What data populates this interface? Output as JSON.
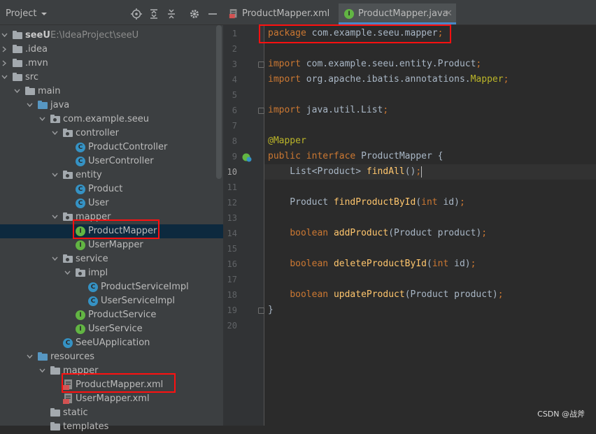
{
  "project": {
    "title": "Project",
    "toolbar_icons": [
      "locate-icon",
      "expand-all-icon",
      "collapse-all-icon",
      "gear-icon",
      "hide-icon"
    ],
    "tree": [
      {
        "label": "seeU",
        "sub": "E:\\IdeaProject\\seeU",
        "kind": "module",
        "expanded": true,
        "depth": 0
      },
      {
        "label": ".idea",
        "kind": "folder",
        "expanded": false,
        "depth": 0
      },
      {
        "label": ".mvn",
        "kind": "folder",
        "expanded": false,
        "depth": 0
      },
      {
        "label": "src",
        "kind": "folder",
        "expanded": true,
        "depth": 0
      },
      {
        "label": "main",
        "kind": "folder",
        "expanded": true,
        "depth": 1
      },
      {
        "label": "java",
        "kind": "source-folder",
        "expanded": true,
        "depth": 2
      },
      {
        "label": "com.example.seeu",
        "kind": "package",
        "expanded": true,
        "depth": 3
      },
      {
        "label": "controller",
        "kind": "package",
        "expanded": true,
        "depth": 4
      },
      {
        "label": "ProductController",
        "kind": "class",
        "depth": 5
      },
      {
        "label": "UserController",
        "kind": "class",
        "depth": 5
      },
      {
        "label": "entity",
        "kind": "package",
        "expanded": true,
        "depth": 4
      },
      {
        "label": "Product",
        "kind": "class",
        "depth": 5
      },
      {
        "label": "User",
        "kind": "class",
        "depth": 5
      },
      {
        "label": "mapper",
        "kind": "package",
        "expanded": true,
        "depth": 4
      },
      {
        "label": "ProductMapper",
        "kind": "interface",
        "depth": 5,
        "selected": true
      },
      {
        "label": "UserMapper",
        "kind": "interface",
        "depth": 5
      },
      {
        "label": "service",
        "kind": "package",
        "expanded": true,
        "depth": 4
      },
      {
        "label": "impl",
        "kind": "package",
        "expanded": true,
        "depth": 5
      },
      {
        "label": "ProductServiceImpl",
        "kind": "class",
        "depth": 6
      },
      {
        "label": "UserServiceImpl",
        "kind": "class",
        "depth": 6
      },
      {
        "label": "ProductService",
        "kind": "interface",
        "depth": 5
      },
      {
        "label": "UserService",
        "kind": "interface",
        "depth": 5
      },
      {
        "label": "SeeUApplication",
        "kind": "app-class",
        "depth": 4
      },
      {
        "label": "resources",
        "kind": "resource-folder",
        "expanded": true,
        "depth": 2
      },
      {
        "label": "mapper",
        "kind": "folder",
        "expanded": true,
        "depth": 3
      },
      {
        "label": "ProductMapper.xml",
        "kind": "xml",
        "depth": 4
      },
      {
        "label": "UserMapper.xml",
        "kind": "xml",
        "depth": 4
      },
      {
        "label": "static",
        "kind": "folder",
        "depth": 3
      },
      {
        "label": "templates",
        "kind": "folder",
        "depth": 3
      }
    ]
  },
  "editor": {
    "tabs": [
      {
        "label": "ProductMapper.xml",
        "icon": "xml-file-icon",
        "active": false
      },
      {
        "label": "ProductMapper.java",
        "icon": "interface-icon",
        "active": true
      }
    ],
    "current_line": 10,
    "lines": [
      [
        {
          "t": "package",
          "c": "kw"
        },
        {
          "t": " com.example.seeu.mapper"
        },
        {
          "t": ";",
          "c": "kw"
        }
      ],
      [],
      [
        {
          "t": "import",
          "c": "kw"
        },
        {
          "t": " com.example.seeu.entity.Product"
        },
        {
          "t": ";",
          "c": "kw"
        }
      ],
      [
        {
          "t": "import",
          "c": "kw"
        },
        {
          "t": " org.apache.ibatis.annotations."
        },
        {
          "t": "Mapper",
          "c": "ann"
        },
        {
          "t": ";",
          "c": "kw"
        }
      ],
      [],
      [
        {
          "t": "import",
          "c": "kw"
        },
        {
          "t": " java.util.List"
        },
        {
          "t": ";",
          "c": "kw"
        }
      ],
      [],
      [
        {
          "t": "@Mapper",
          "c": "ann"
        }
      ],
      [
        {
          "t": "public interface ",
          "c": "kw"
        },
        {
          "t": "ProductMapper {"
        }
      ],
      [
        {
          "t": "    List<Product> "
        },
        {
          "t": "findAll",
          "c": "fn"
        },
        {
          "t": "()"
        },
        {
          "t": ";",
          "c": "kw"
        },
        {
          "caret": true
        }
      ],
      [],
      [
        {
          "t": "    Product "
        },
        {
          "t": "findProductById",
          "c": "fn"
        },
        {
          "t": "("
        },
        {
          "t": "int ",
          "c": "kw"
        },
        {
          "t": "id)"
        },
        {
          "t": ";",
          "c": "kw"
        }
      ],
      [],
      [
        {
          "t": "    "
        },
        {
          "t": "boolean ",
          "c": "kw"
        },
        {
          "t": "addProduct",
          "c": "fn"
        },
        {
          "t": "(Product product)"
        },
        {
          "t": ";",
          "c": "kw"
        }
      ],
      [],
      [
        {
          "t": "    "
        },
        {
          "t": "boolean ",
          "c": "kw"
        },
        {
          "t": "deleteProductById",
          "c": "fn"
        },
        {
          "t": "("
        },
        {
          "t": "int ",
          "c": "kw"
        },
        {
          "t": "id)"
        },
        {
          "t": ";",
          "c": "kw"
        }
      ],
      [],
      [
        {
          "t": "    "
        },
        {
          "t": "boolean ",
          "c": "kw"
        },
        {
          "t": "updateProduct",
          "c": "fn"
        },
        {
          "t": "(Product product)"
        },
        {
          "t": ";",
          "c": "kw"
        }
      ],
      [
        {
          "t": "}"
        }
      ],
      []
    ],
    "fold_markers_at_lines": [
      3,
      6,
      19
    ],
    "gutter_icon_line": 9,
    "gutter_icon": "implemented-icon"
  },
  "watermark": "CSDN @战斧",
  "colors": {
    "keyword": "#cc7832",
    "function": "#ffc66d",
    "annotation": "#bbb529",
    "highlight_box": "#ff1010",
    "selection": "#0d293e"
  }
}
